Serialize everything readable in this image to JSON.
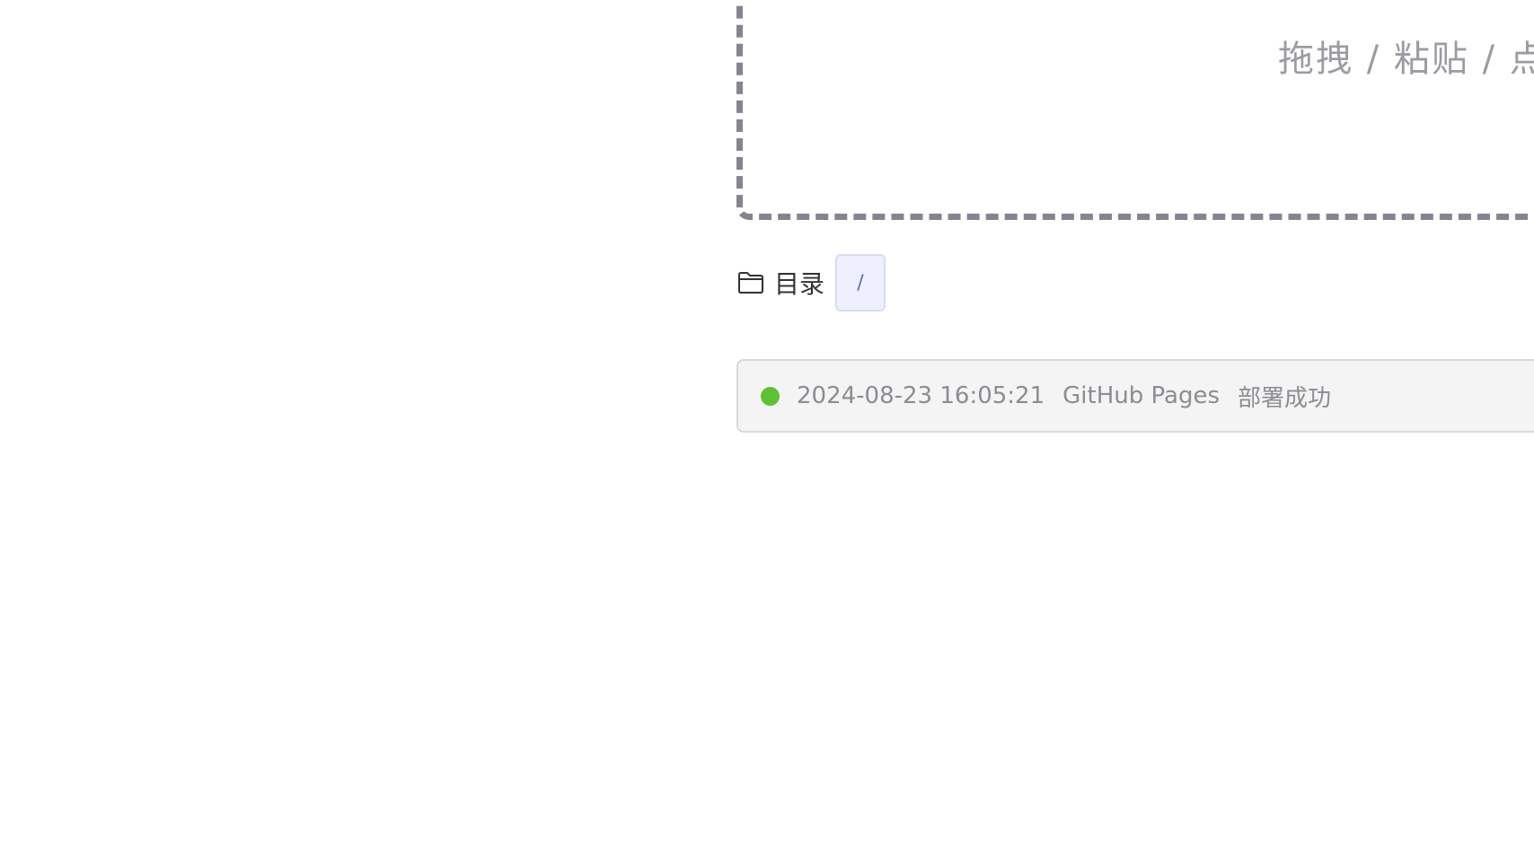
{
  "upload": {
    "hint": "拖拽 / 粘贴 / 点击"
  },
  "directory": {
    "icon": "folder-icon",
    "label": "目录",
    "path": "/"
  },
  "deploy_status": {
    "status_color": "#5ec033",
    "timestamp": "2024-08-23 16:05:21",
    "platform": "GitHub Pages",
    "message": "部署成功"
  }
}
